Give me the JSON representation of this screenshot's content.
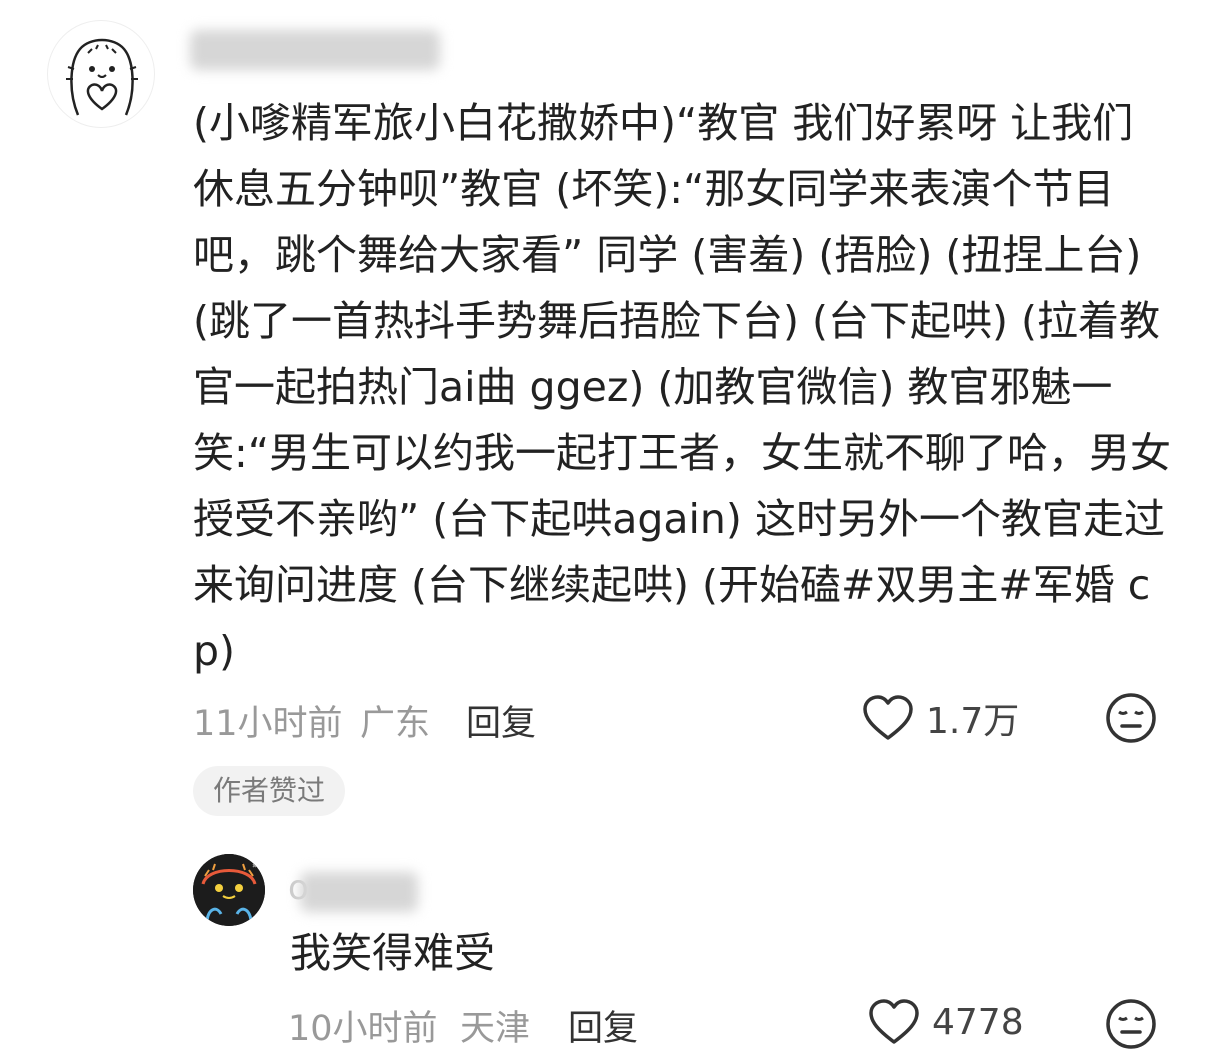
{
  "comment": {
    "text": "(小嗲精军旅小白花撒娇中)“教官 我们好累呀 让我们休息五分钟呗”教官 (坏笑):“那女同学来表演个节目吧，跳个舞给大家看” 同学 (害羞) (捂脸) (扭捏上台) (跳了一首热抖手势舞后捂脸下台) (台下起哄) (拉着教官一起拍热门ai曲 ggez) (加教官微信) 教官邪魅一笑:“男生可以约我一起打王者，女生就不聊了哈，男女授受不亲哟” (台下起哄again) 这时另外一个教官走过来询问进度 (台下继续起哄) (开始磕#双男主#军婚 cp)",
    "time": "11小时前",
    "location": "广东",
    "reply_label": "回复",
    "like_count": "1.7万",
    "badge": "作者赞过"
  },
  "reply": {
    "name_initial": "o",
    "text": "我笑得难受",
    "time": "10小时前",
    "location": "天津",
    "reply_label": "回复",
    "like_count": "4778"
  },
  "icons": {
    "like": "heart-outline-icon",
    "reaction": "meh-face-icon"
  }
}
